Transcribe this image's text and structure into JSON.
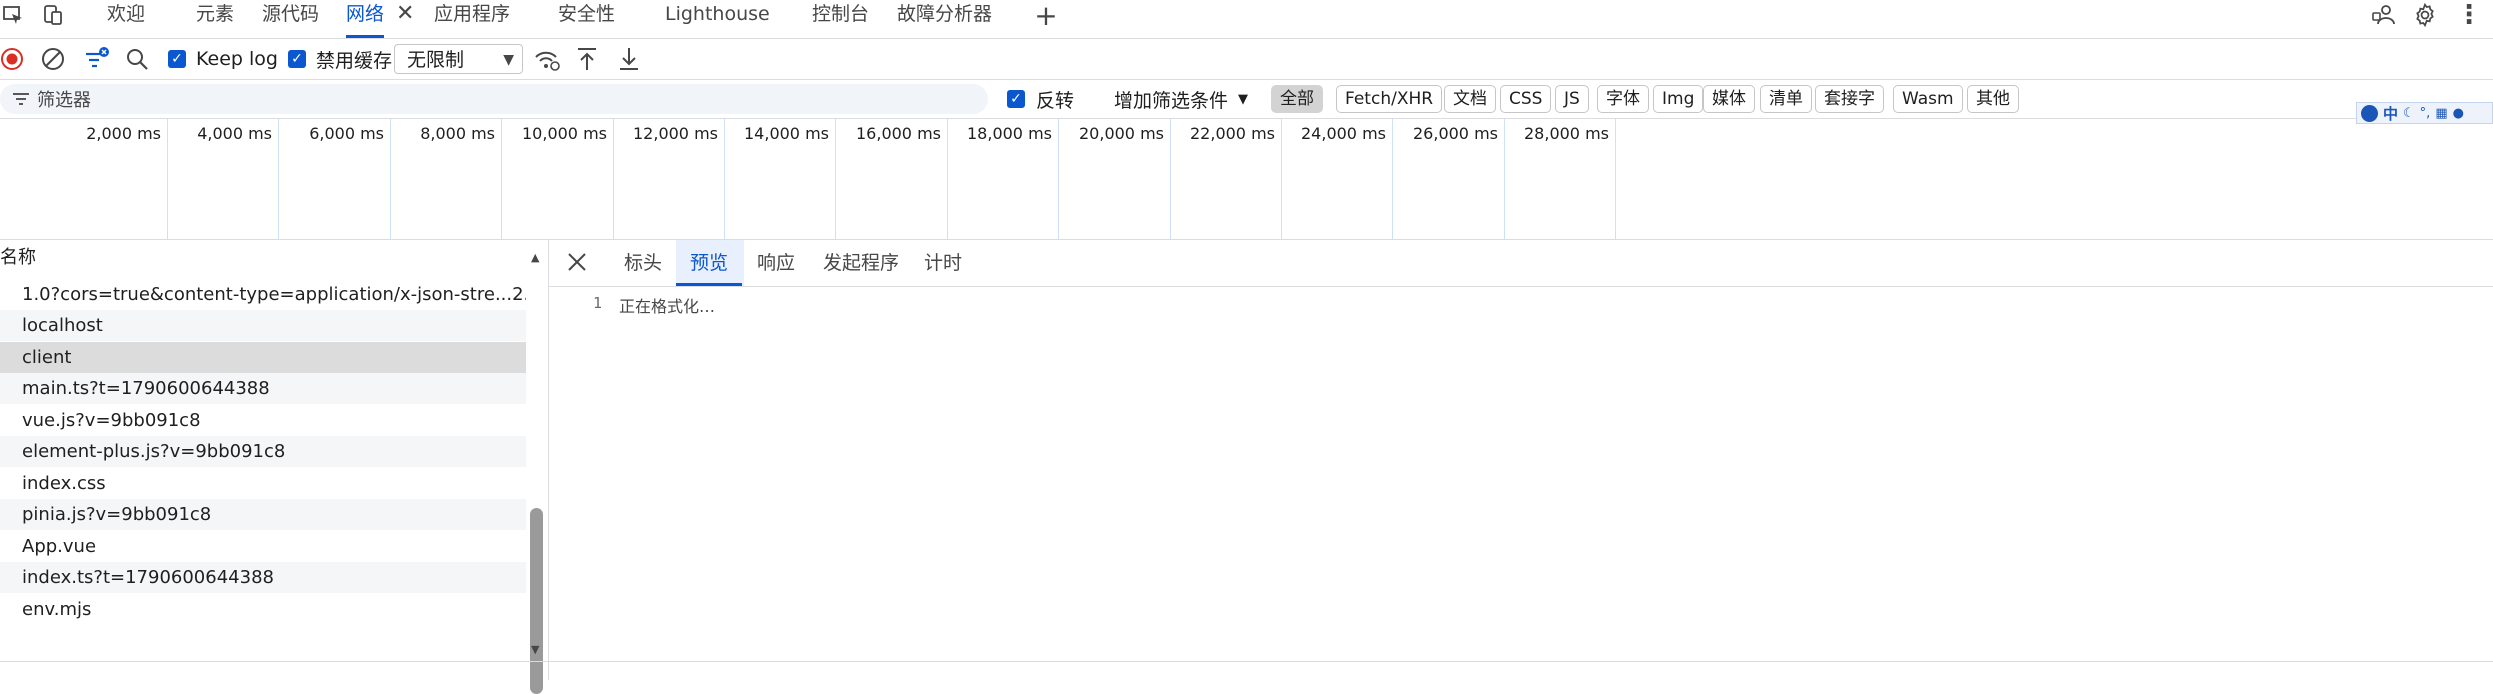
{
  "tabs": [
    "欢迎",
    "元素",
    "源代码",
    "网络",
    "应用程序",
    "安全性",
    "Lighthouse",
    "控制台",
    "故障分析器"
  ],
  "toolbar": {
    "keep_log": "Keep log",
    "disable_cache": "禁用缓存",
    "throttle": "无限制"
  },
  "filter": {
    "placeholder": "筛选器",
    "invert": "反转",
    "more_filters": "增加筛选条件",
    "types": [
      "全部",
      "Fetch/XHR",
      "文档",
      "CSS",
      "JS",
      "字体",
      "Img",
      "媒体",
      "清单",
      "套接字",
      "Wasm",
      "其他"
    ]
  },
  "timeline": {
    "ticks": [
      "2,000 ms",
      "4,000 ms",
      "6,000 ms",
      "8,000 ms",
      "10,000 ms",
      "12,000 ms",
      "14,000 ms",
      "16,000 ms",
      "18,000 ms",
      "20,000 ms",
      "22,000 ms",
      "24,000 ms",
      "26,000 ms",
      "28,000 ms"
    ]
  },
  "ime": {
    "label": "中"
  },
  "requests": {
    "header": "名称",
    "rows": [
      "1.0?cors=true&content-type=application/x-json-stre...2...",
      "localhost",
      "client",
      "main.ts?t=1790600644388",
      "vue.js?v=9bb091c8",
      "element-plus.js?v=9bb091c8",
      "index.css",
      "pinia.js?v=9bb091c8",
      "App.vue",
      "index.ts?t=1790600644388",
      "env.mjs"
    ]
  },
  "detail": {
    "tabs": [
      "标头",
      "预览",
      "响应",
      "发起程序",
      "计时"
    ],
    "line_number": "1",
    "preview_text": "正在格式化…"
  },
  "colors": {
    "accent": "#0b57d0",
    "record": "#d93025"
  }
}
